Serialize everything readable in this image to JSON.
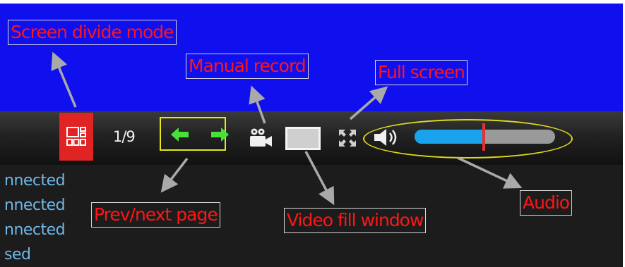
{
  "callouts": {
    "screen_divide_mode": "Screen divide mode",
    "manual_record": "Manual record",
    "full_screen": "Full screen",
    "prev_next_page": "Prev/next page",
    "video_fill_window": "Video fill window",
    "audio": "Audio"
  },
  "toolbar": {
    "page_counter": "1/9",
    "volume_level": 0.5,
    "icons": {
      "divide": "grid-layout-icon",
      "prev": "arrow-left-icon",
      "next": "arrow-right-icon",
      "record": "video-camera-icon",
      "fill": "fill-window-icon",
      "fullscreen": "expand-icon",
      "audio": "speaker-icon"
    }
  },
  "status_lines": [
    "nnected",
    "nnected",
    "nnected",
    "sed"
  ],
  "colors": {
    "video_area": "#1010ee",
    "callout_text": "#ff1616",
    "divide_button": "#e02424",
    "nav_arrow": "#49e03a",
    "highlight": "#e6e619",
    "volume_fill": "#1aa3ec",
    "volume_thumb": "#e53030",
    "status_text": "#6fb7e8"
  }
}
